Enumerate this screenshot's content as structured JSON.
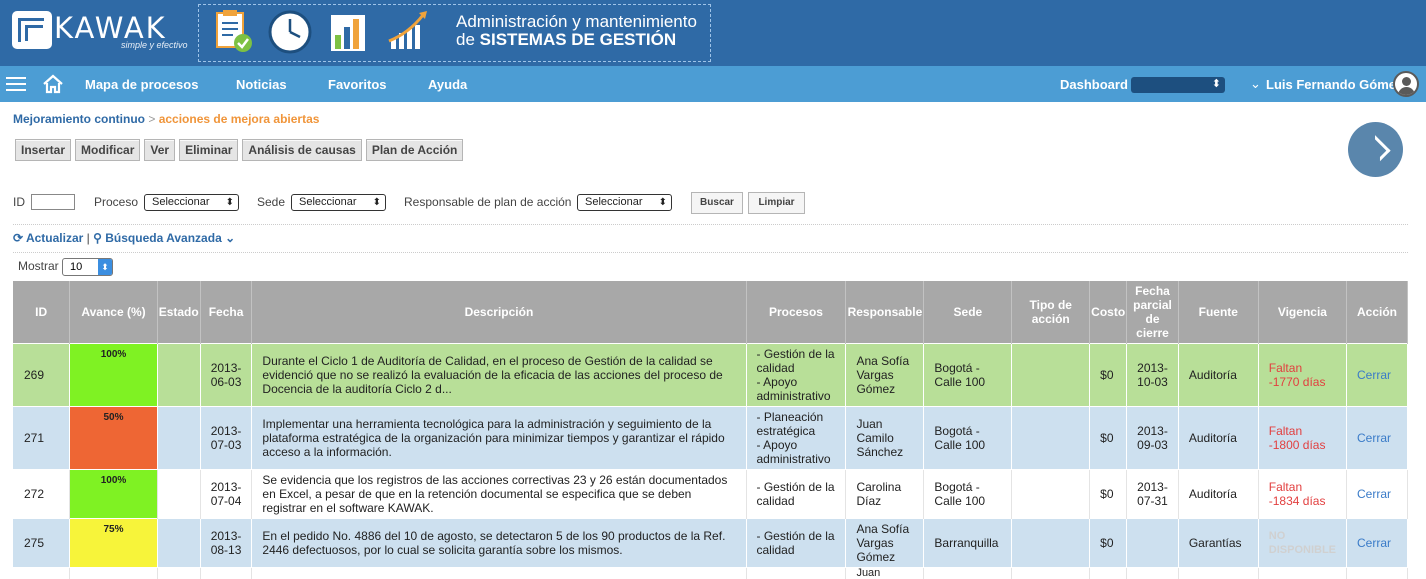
{
  "banner": {
    "logo_text": "KAWAK",
    "logo_tagline": "simple y efectivo",
    "title_line1": "Administración y mantenimiento",
    "title_line2_prefix": "de",
    "title_line2_strong": "SISTEMAS DE GESTIÓN"
  },
  "nav": {
    "items": [
      "Mapa de procesos",
      "Noticias",
      "Favoritos",
      "Ayuda"
    ],
    "dashboard_label": "Dashboard",
    "user_name": "Luis Fernando Gómez"
  },
  "breadcrumb": {
    "parent": "Mejoramiento continuo",
    "separator": ">",
    "current": "acciones de mejora abiertas"
  },
  "toolbar": [
    "Insertar",
    "Modificar",
    "Ver",
    "Eliminar",
    "Análisis de causas",
    "Plan de Acción"
  ],
  "filters": {
    "id_label": "ID",
    "proceso_label": "Proceso",
    "proceso_value": "Seleccionar",
    "sede_label": "Sede",
    "sede_value": "Seleccionar",
    "responsable_label": "Responsable de plan de acción",
    "responsable_value": "Seleccionar",
    "buscar": "Buscar",
    "limpiar": "Limpiar"
  },
  "actions": {
    "refresh": "Actualizar",
    "separator": "|",
    "advanced": "Búsqueda Avanzada"
  },
  "paging": {
    "show_label": "Mostrar",
    "show_value": "10"
  },
  "table": {
    "headers": [
      "ID",
      "Avance (%)",
      "Estado",
      "Fecha",
      "Descripción",
      "Procesos",
      "Responsable",
      "Sede",
      "Tipo de acción",
      "Costo",
      "Fecha parcial de cierre",
      "Fuente",
      "Vigencia",
      "Acción"
    ],
    "rows": [
      {
        "id": "269",
        "avance": "100%",
        "avance_color": "#7ff223",
        "estado": "",
        "fecha_a": "2013-",
        "fecha_b": "06-03",
        "descripcion": "Durante el Ciclo 1 de Auditoría de Calidad, en el proceso de Gestión de la calidad se evidenció que no se realizó la evaluación de la eficacia de las acciones del proceso de Docencia de la auditoría Ciclo 2 d...",
        "procesos": [
          "- Gestión de la calidad",
          "- Apoyo administrativo"
        ],
        "responsable": "Ana Sofía Vargas Gómez",
        "sede": "Bogotá - Calle 100",
        "tipo": "",
        "costo": "$0",
        "cierre_a": "2013-",
        "cierre_b": "10-03",
        "fuente": "Auditoría",
        "vigencia_a": "Faltan",
        "vigencia_b": "-1770 días",
        "accion": "Cerrar"
      },
      {
        "id": "271",
        "avance": "50%",
        "avance_color": "#ee6634",
        "estado": "",
        "fecha_a": "2013-",
        "fecha_b": "07-03",
        "descripcion": "Implementar una herramienta tecnológica para la administración y seguimiento de la plataforma estratégica de la organización para minimizar tiempos y garantizar el rápido acceso a la información.",
        "procesos": [
          "- Planeación estratégica",
          "- Apoyo administrativo"
        ],
        "responsable": "Juan Camilo Sánchez",
        "sede": "Bogotá - Calle 100",
        "tipo": "",
        "costo": "$0",
        "cierre_a": "2013-",
        "cierre_b": "09-03",
        "fuente": "Auditoría",
        "vigencia_a": "Faltan",
        "vigencia_b": "-1800 días",
        "accion": "Cerrar"
      },
      {
        "id": "272",
        "avance": "100%",
        "avance_color": "#7ff223",
        "estado": "",
        "fecha_a": "2013-",
        "fecha_b": "07-04",
        "descripcion": "Se evidencia que los registros de las acciones correctivas 23 y 26 están documentados en Excel, a pesar de que en la retención documental se especifica que se deben registrar en el software KAWAK.",
        "procesos": [
          "- Gestión de la calidad"
        ],
        "responsable": "Carolina Díaz",
        "sede": "Bogotá - Calle 100",
        "tipo": "",
        "costo": "$0",
        "cierre_a": "2013-",
        "cierre_b": "07-31",
        "fuente": "Auditoría",
        "vigencia_a": "Faltan",
        "vigencia_b": "-1834 días",
        "accion": "Cerrar"
      },
      {
        "id": "275",
        "avance": "75%",
        "avance_color": "#f7f43a",
        "estado": "",
        "fecha_a": "2013-",
        "fecha_b": "08-13",
        "descripcion": "En el pedido No. 4886 del 10 de agosto, se detectaron 5 de los 90 productos de la Ref. 2446 defectuosos, por lo cual se solicita garantía sobre los mismos.",
        "procesos": [
          "- Gestión de la calidad"
        ],
        "responsable": "Ana Sofía Vargas Gómez",
        "sede": "Barranquilla",
        "tipo": "",
        "costo": "$0",
        "cierre_a": "",
        "cierre_b": "",
        "fuente": "Garantías",
        "vigencia_a": "NO",
        "vigencia_b": "DISPONIBLE",
        "accion": "Cerrar"
      }
    ],
    "partial_row_responsable": "Juan"
  },
  "colors": {
    "banner": "#2f6aa6",
    "navbar": "#4c9dd4",
    "row_green": "#b8df98",
    "row_blue": "#cde0ef",
    "header_grey": "#a8a8a8",
    "link_blue": "#3a7bc8",
    "breadcrumb_orange": "#f0953a",
    "overdue_red": "#e23f3f"
  },
  "icons": [
    "hamburger-icon",
    "home-icon",
    "user-avatar-icon",
    "play-icon",
    "refresh-icon",
    "search-icon",
    "chevron-down-icon",
    "checklist-icon",
    "clock-icon",
    "bar-chart-icon",
    "growth-arrow-icon"
  ]
}
